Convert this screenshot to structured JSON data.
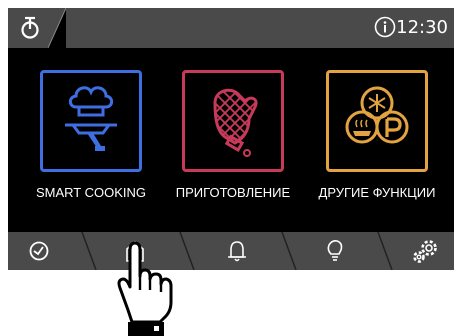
{
  "topbar": {
    "time": "12:30",
    "power_icon": "power-icon",
    "info_icon": "info-icon"
  },
  "cards": [
    {
      "label": "SMART COOKING",
      "icon": "chef-serving-tray-icon",
      "accent": "#3e6ee0"
    },
    {
      "label": "ПРИГОТОВЛЕНИЕ",
      "icon": "oven-mitt-icon",
      "accent": "#c83a5a"
    },
    {
      "label": "ДРУГИЕ ФУНКЦИИ",
      "icon": "other-functions-icon",
      "accent": "#e3a340"
    }
  ],
  "bottombar": {
    "tabs": [
      {
        "icon": "timer-icon"
      },
      {
        "icon": "oven-home-icon"
      },
      {
        "icon": "bell-icon"
      },
      {
        "icon": "lightbulb-icon"
      },
      {
        "icon": "settings-gears-icon"
      }
    ]
  },
  "overlay": {
    "icon": "pointing-hand-icon"
  },
  "colors": {
    "bar": "#4a4a4a",
    "screen": "#000000",
    "text": "#ffffff"
  }
}
